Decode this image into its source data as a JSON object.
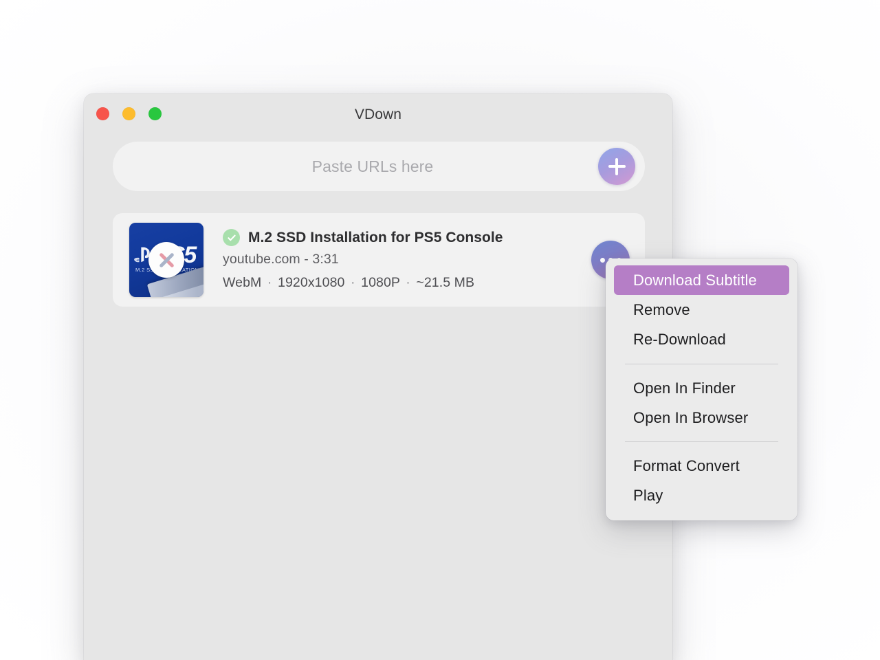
{
  "window": {
    "title": "VDown",
    "traffic_lights": [
      {
        "name": "close",
        "color": "#f7544b"
      },
      {
        "name": "minimize",
        "color": "#fdbc2d"
      },
      {
        "name": "maximize",
        "color": "#29c73f"
      }
    ]
  },
  "url_bar": {
    "placeholder": "Paste URLs here",
    "value": "",
    "add_button_icon": "plus-icon"
  },
  "downloads": [
    {
      "title": "M.2 SSD Installation for PS5 Console",
      "source": "youtube.com - 3:31",
      "status_icon": "check-circle-icon",
      "meta": {
        "format": "WebM",
        "resolution": "1920x1080",
        "quality": "1080P",
        "size": "~21.5 MB",
        "separator": "·",
        "full": "WebM · 1920x1080 · 1080P · ~21.5 MB"
      },
      "thumbnail": {
        "brand": "PS5",
        "caption": "M.2 SSD INSTALLATION",
        "overlay_icon": "close-x-icon"
      },
      "more_button_icon": "ellipsis-icon"
    }
  ],
  "context_menu": {
    "groups": [
      {
        "items": [
          {
            "label": "Download Subtitle",
            "highlighted": true
          },
          {
            "label": "Remove",
            "highlighted": false
          },
          {
            "label": "Re-Download",
            "highlighted": false
          }
        ]
      },
      {
        "items": [
          {
            "label": "Open In Finder",
            "highlighted": false
          },
          {
            "label": "Open In Browser",
            "highlighted": false
          }
        ]
      },
      {
        "items": [
          {
            "label": "Format Convert",
            "highlighted": false
          },
          {
            "label": "Play",
            "highlighted": false
          }
        ]
      }
    ]
  },
  "colors": {
    "window_bg": "#e6e6e6",
    "card_bg": "#f2f2f2",
    "menu_bg": "#ebebeb",
    "menu_highlight": "#b57ec6",
    "accent_gradient_start": "#8fa6e9",
    "accent_gradient_end": "#d39ad2",
    "status_green": "#a8dfac"
  }
}
